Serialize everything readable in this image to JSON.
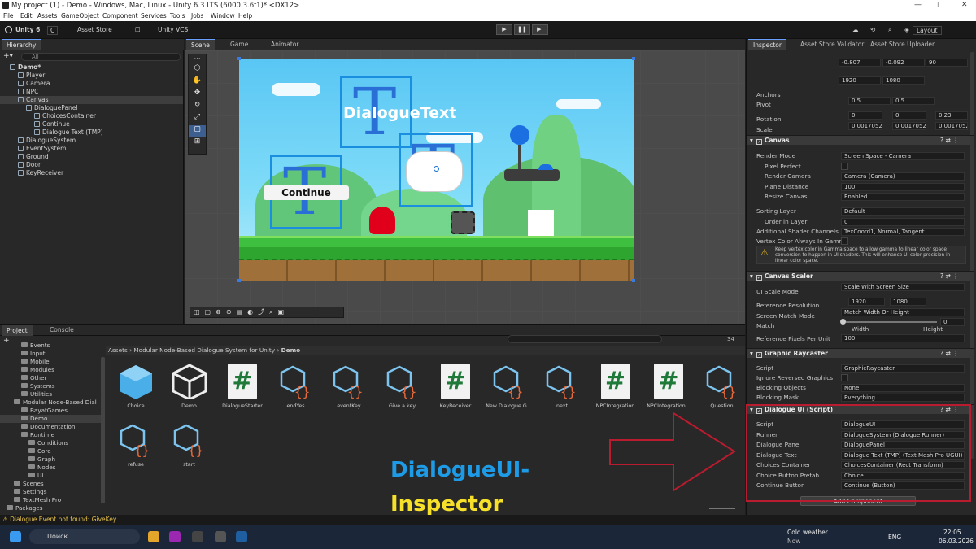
{
  "window": {
    "title": "My project (1) - Demo - Windows, Mac, Linux - Unity 6.3 LTS (6000.3.6f1)* <DX12>"
  },
  "menu": [
    "File",
    "Edit",
    "Assets",
    "GameObject",
    "Component",
    "Services",
    "Tools",
    "Jobs",
    "Window",
    "Help"
  ],
  "toolbar": {
    "unity_label": "Unity 6",
    "account": "C",
    "asset_store": "Asset Store",
    "vcs": "Unity VCS",
    "layout": "Layout"
  },
  "hierarchy": {
    "tab": "Hierarchy",
    "search_placeholder": "All",
    "items": [
      {
        "label": "Demo*",
        "indent": 0,
        "root": true
      },
      {
        "label": "Player",
        "indent": 1
      },
      {
        "label": "Camera",
        "indent": 1
      },
      {
        "label": "NPC",
        "indent": 1
      },
      {
        "label": "Canvas",
        "indent": 1,
        "selected": true
      },
      {
        "label": "DialoguePanel",
        "indent": 2
      },
      {
        "label": "ChoicesContainer",
        "indent": 3
      },
      {
        "label": "Continue",
        "indent": 3
      },
      {
        "label": "Dialogue Text (TMP)",
        "indent": 3
      },
      {
        "label": "DialogueSystem",
        "indent": 1
      },
      {
        "label": "EventSystem",
        "indent": 1
      },
      {
        "label": "Ground",
        "indent": 1
      },
      {
        "label": "Door",
        "indent": 1
      },
      {
        "label": "KeyReceiver",
        "indent": 1
      }
    ]
  },
  "scene": {
    "tabs": [
      "Scene",
      "Game",
      "Animator"
    ],
    "dialogue_text": "DialogueText",
    "continue_text": "Continue"
  },
  "project": {
    "tabs": [
      "Project",
      "Console"
    ],
    "breadcrumb": [
      "Assets",
      "Modular Node-Based Dialogue System for Unity",
      "Demo"
    ],
    "count": "34",
    "tree": [
      {
        "label": "Events",
        "indent": 2
      },
      {
        "label": "Input",
        "indent": 2
      },
      {
        "label": "Mobile",
        "indent": 2
      },
      {
        "label": "Modules",
        "indent": 2
      },
      {
        "label": "Other",
        "indent": 2
      },
      {
        "label": "Systems",
        "indent": 2
      },
      {
        "label": "Utilities",
        "indent": 2
      },
      {
        "label": "Modular Node-Based Dial",
        "indent": 1
      },
      {
        "label": "BayatGames",
        "indent": 2
      },
      {
        "label": "Demo",
        "indent": 2,
        "selected": true
      },
      {
        "label": "Documentation",
        "indent": 2
      },
      {
        "label": "Runtime",
        "indent": 2
      },
      {
        "label": "Conditions",
        "indent": 3
      },
      {
        "label": "Core",
        "indent": 3
      },
      {
        "label": "Graph",
        "indent": 3
      },
      {
        "label": "Nodes",
        "indent": 3
      },
      {
        "label": "UI",
        "indent": 3
      },
      {
        "label": "Scenes",
        "indent": 1
      },
      {
        "label": "Settings",
        "indent": 1
      },
      {
        "label": "TextMesh Pro",
        "indent": 1
      },
      {
        "label": "Packages",
        "indent": 0
      }
    ],
    "assets": [
      {
        "label": "Choice",
        "kind": "prefab"
      },
      {
        "label": "Demo",
        "kind": "unity"
      },
      {
        "label": "DialogueStarter",
        "kind": "cs"
      },
      {
        "label": "endYes",
        "kind": "node"
      },
      {
        "label": "eventKey",
        "kind": "node"
      },
      {
        "label": "Give a key",
        "kind": "node"
      },
      {
        "label": "KeyReceiver",
        "kind": "cs"
      },
      {
        "label": "New Dialogue G...",
        "kind": "node"
      },
      {
        "label": "next",
        "kind": "node"
      },
      {
        "label": "NPCIntegration",
        "kind": "cs"
      },
      {
        "label": "NPCIntegration...",
        "kind": "cs"
      },
      {
        "label": "Question",
        "kind": "node"
      },
      {
        "label": "refuse",
        "kind": "node"
      },
      {
        "label": "start",
        "kind": "node"
      }
    ]
  },
  "overlay": {
    "line1": "DialogueUI-",
    "line2": "Inspector"
  },
  "inspector": {
    "tabs": [
      "Inspector",
      "Asset Store Validator",
      "Asset Store Uploader"
    ],
    "top": {
      "pos_a": "Pos X",
      "pos_b": "Pos Y",
      "pos_c": "Pos Z",
      "v1": "-0.807",
      "v2": "-0.092",
      "v3": "90",
      "w_label": "Width",
      "h_label": "Height",
      "w": "1920",
      "h": "1080"
    },
    "anchors": "Anchors",
    "pivot": {
      "label": "Pivot",
      "x": "X",
      "xv": "0.5",
      "y": "Y",
      "yv": "0.5"
    },
    "rotation": {
      "label": "Rotation",
      "x": "0",
      "y": "0",
      "z": "0.23"
    },
    "scale": {
      "label": "Scale",
      "x": "0.0017052",
      "y": "0.0017052",
      "z": "0.0017052"
    },
    "canvas": {
      "title": "Canvas",
      "rows": [
        [
          "Render Mode",
          "Screen Space - Camera"
        ],
        [
          "Pixel Perfect",
          ""
        ],
        [
          "Render Camera",
          "Camera (Camera)"
        ],
        [
          "Plane Distance",
          "100"
        ],
        [
          "Resize Canvas",
          "Enabled"
        ],
        [
          "Sorting Layer",
          "Default"
        ],
        [
          "Order in Layer",
          "0"
        ],
        [
          "Additional Shader Channels",
          "TexCoord1, Normal, Tangent"
        ],
        [
          "Vertex Color Always In Gamma",
          ""
        ]
      ],
      "warning": "Keep vertex color in Gamma space to allow gamma to linear color space conversion to happen in UI shaders. This will enhance UI color precision in linear color space."
    },
    "scaler": {
      "title": "Canvas Scaler",
      "ui_scale_label": "UI Scale Mode",
      "ui_scale": "Scale With Screen Size",
      "ref_label": "Reference Resolution",
      "ref_x": "1920",
      "ref_y": "1080",
      "match_mode_label": "Screen Match Mode",
      "match_mode": "Match Width Or Height",
      "match_label": "Match",
      "match_val": "0",
      "width": "Width",
      "height": "Height",
      "ppu_label": "Reference Pixels Per Unit",
      "ppu": "100"
    },
    "raycaster": {
      "title": "Graphic Raycaster",
      "rows": [
        [
          "Script",
          "GraphicRaycaster"
        ],
        [
          "Ignore Reversed Graphics",
          ""
        ],
        [
          "Blocking Objects",
          "None"
        ],
        [
          "Blocking Mask",
          "Everything"
        ]
      ]
    },
    "dialogue": {
      "title": "Dialogue Ui (Script)",
      "rows": [
        [
          "Script",
          "DialogueUI"
        ],
        [
          "Runner",
          "DialogueSystem (Dialogue Runner)"
        ],
        [
          "Dialogue Panel",
          "DialoguePanel"
        ],
        [
          "Dialogue Text",
          "Dialogue Text (TMP) (Text Mesh Pro UGUI)"
        ],
        [
          "Choices Container",
          "ChoicesContainer (Rect Transform)"
        ],
        [
          "Choice Button Prefab",
          "Choice"
        ],
        [
          "Continue Button",
          "Continue (Button)"
        ]
      ]
    },
    "add_component": "Add Component"
  },
  "status": {
    "message": "Dialogue Event not found: GiveKey"
  },
  "taskbar": {
    "search": "Поиск",
    "weather": "Cold weather",
    "weather_sub": "Now",
    "lang": "ENG",
    "time": "22:05",
    "date": "06.03.2026"
  }
}
